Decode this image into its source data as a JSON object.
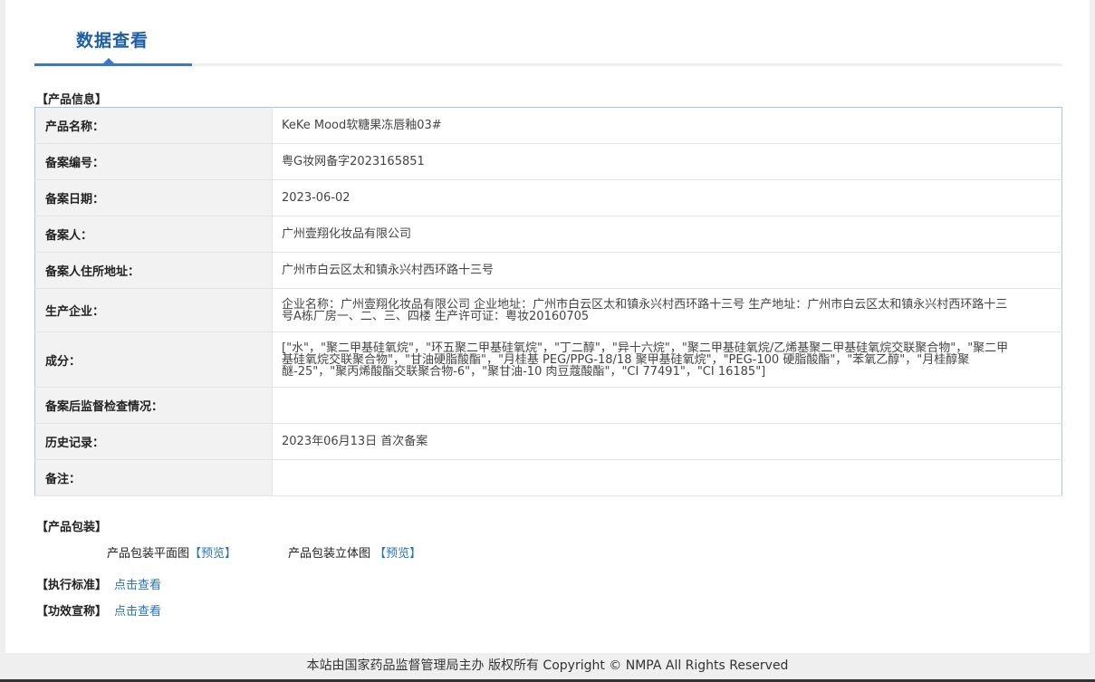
{
  "tab": {
    "title": "数据查看"
  },
  "sections": {
    "product_info": "【产品信息】",
    "packaging": "【产品包装】",
    "standard": "【执行标准】",
    "efficacy": "【功效宣称】"
  },
  "info_rows": [
    {
      "label": "产品名称：",
      "value": "KeKe Mood软糖果冻唇釉03#"
    },
    {
      "label": "备案编号：",
      "value": "粤G妆网备字2023165851"
    },
    {
      "label": "备案日期：",
      "value": "2023-06-02"
    },
    {
      "label": "备案人：",
      "value": "广州壹翔化妆品有限公司"
    },
    {
      "label": "备案人住所地址：",
      "value": "广州市白云区太和镇永兴村西环路十三号"
    },
    {
      "label": "生产企业：",
      "value": "企业名称：广州壹翔化妆品有限公司 企业地址：广州市白云区太和镇永兴村西环路十三号 生产地址：广州市白云区太和镇永兴村西环路十三号A栋厂房一、二、三、四楼 生产许可证：粤妆20160705"
    },
    {
      "label": "成分：",
      "value": "[\"水\"，\"聚二甲基硅氧烷\"，\"环五聚二甲基硅氧烷\"，\"丁二醇\"，\"异十六烷\"，\"聚二甲基硅氧烷/乙烯基聚二甲基硅氧烷交联聚合物\"，\"聚二甲基硅氧烷交联聚合物\"，\"甘油硬脂酸酯\"，\"月桂基 PEG/PPG-18/18 聚甲基硅氧烷\"，\"PEG-100 硬脂酸酯\"，\"苯氧乙醇\"，\"月桂醇聚醚-25\"，\"聚丙烯酸酯交联聚合物-6\"，\"聚甘油-10 肉豆蔻酸酯\"，\"CI 77491\"，\"CI 16185\"]"
    },
    {
      "label": "备案后监督检查情况：",
      "value": ""
    },
    {
      "label": "历史记录：",
      "value": "2023年06月13日 首次备案"
    },
    {
      "label": "备注：",
      "value": ""
    }
  ],
  "packaging": {
    "flat_label": "产品包装平面图",
    "flat_link": "【预览】",
    "solid_label": "产品包装立体图",
    "solid_link": "【预览】"
  },
  "links": {
    "standard_link": "点击查看",
    "efficacy_link": "点击查看"
  },
  "footer": {
    "text": "本站由国家药品监督管理局主办 版权所有 Copyright © NMPA All Rights Reserved"
  }
}
